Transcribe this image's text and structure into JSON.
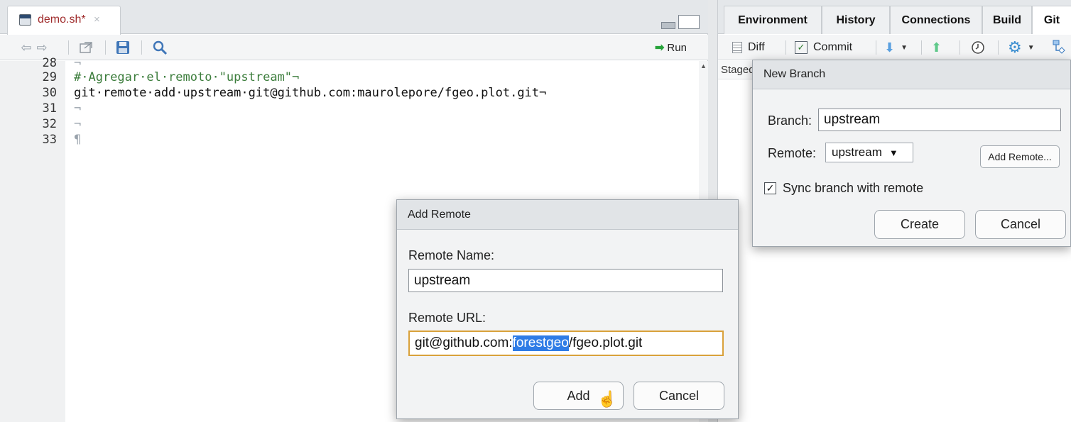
{
  "editor": {
    "tab": {
      "filename": "demo.sh*",
      "close_glyph": "×"
    },
    "toolbar": {
      "run_label": "Run"
    },
    "lines": [
      {
        "num": "28",
        "text": "¬"
      },
      {
        "num": "29",
        "text": "#·Agregar·el·remoto·\"upstream\"¬"
      },
      {
        "num": "30",
        "text": "git·remote·add·upstream·git@github.com:maurolepore/fgeo.plot.git¬"
      },
      {
        "num": "31",
        "text": "¬"
      },
      {
        "num": "32",
        "text": "¬"
      },
      {
        "num": "33",
        "text": "¶"
      }
    ]
  },
  "right_pane": {
    "tabs": [
      "Environment",
      "History",
      "Connections",
      "Build",
      "Git"
    ],
    "active_tab": "Git",
    "toolbar": {
      "diff_label": "Diff",
      "commit_label": "Commit"
    },
    "staged_header": "Staged"
  },
  "new_branch_dialog": {
    "title": "New Branch",
    "branch_label": "Branch:",
    "branch_value": "upstream",
    "remote_label": "Remote:",
    "remote_value": "upstream",
    "remote_caret": "▼",
    "add_remote_label": "Add Remote...",
    "sync_label": "Sync branch with remote",
    "sync_checked": true,
    "create_label": "Create",
    "cancel_label": "Cancel"
  },
  "add_remote_dialog": {
    "title": "Add Remote",
    "name_label": "Remote Name:",
    "name_value": "upstream",
    "url_label": "Remote URL:",
    "url_before": "git@github.com:",
    "url_selected": "forestgeo",
    "url_after": "/fgeo.plot.git",
    "add_label": "Add",
    "cancel_label": "Cancel"
  },
  "colors": {
    "comment": "#3c7d3c",
    "selection": "#2f7ce6",
    "focus_border": "#d9a13a",
    "filename": "#a02d2d"
  }
}
